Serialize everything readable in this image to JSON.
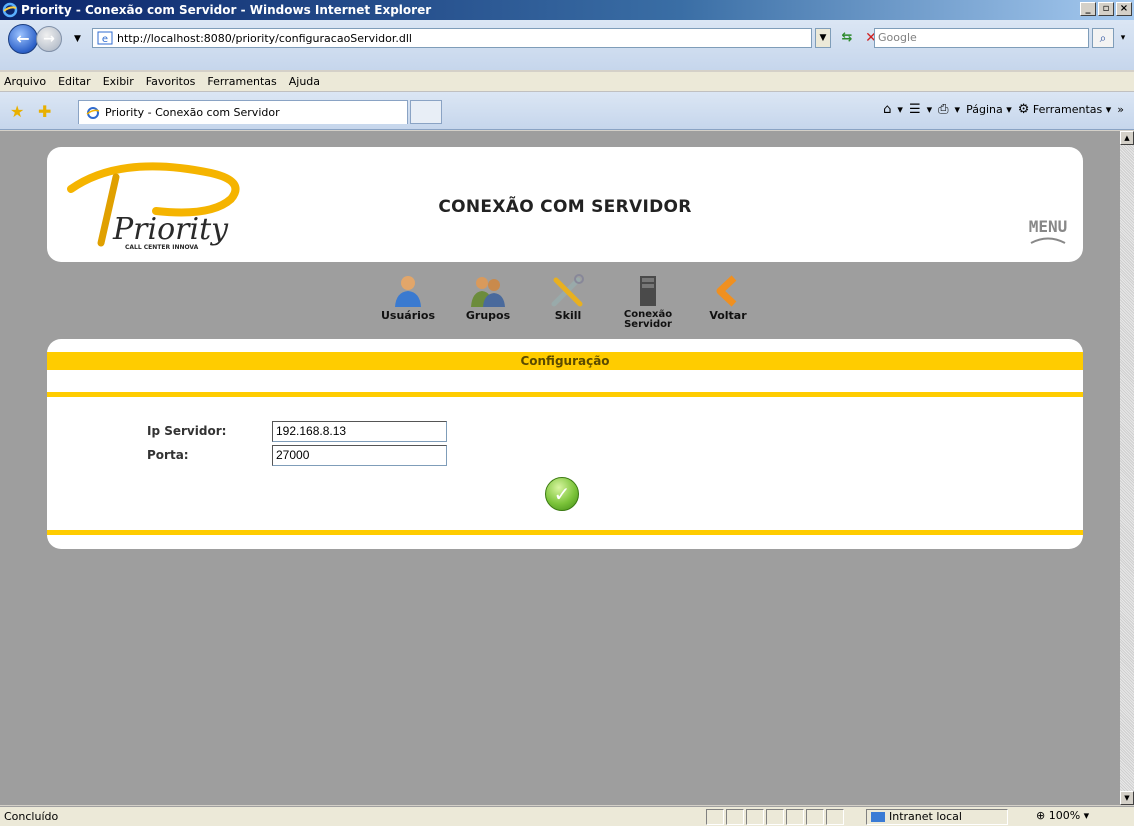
{
  "window": {
    "title": "Priority - Conexão com Servidor - Windows Internet Explorer",
    "buttons": [
      "_",
      "▫",
      "×"
    ]
  },
  "address_bar": {
    "url": "http://localhost:8080/priority/configuracaoServidor.dll",
    "search_placeholder": "Google"
  },
  "menu": {
    "items": [
      "Arquivo",
      "Editar",
      "Exibir",
      "Favoritos",
      "Ferramentas",
      "Ajuda"
    ]
  },
  "tabs": {
    "active_label": "Priority - Conexão com Servidor"
  },
  "command_bar": {
    "page_label": "Página",
    "tools_label": "Ferramentas"
  },
  "page": {
    "title": "CONEXÃO COM SERVIDOR",
    "menu_link": "MENU",
    "logo_text": "Priority",
    "logo_subtitle": "CALL CENTER INNOVA",
    "toolbar": [
      {
        "label": "Usuários"
      },
      {
        "label": "Grupos"
      },
      {
        "label": "Skill"
      },
      {
        "label": "Conexão Servidor"
      },
      {
        "label": "Voltar"
      }
    ],
    "config_heading": "Configuração",
    "fields": {
      "ip_label": "Ip Servidor:",
      "ip_value": "192.168.8.13",
      "port_label": "Porta:",
      "port_value": "27000"
    }
  },
  "status_bar": {
    "text": "Concluído",
    "zone": "Intranet local",
    "zoom": "100%"
  },
  "colors": {
    "accent_yellow": "#ffcc00",
    "content_bg": "#9e9e9e"
  }
}
